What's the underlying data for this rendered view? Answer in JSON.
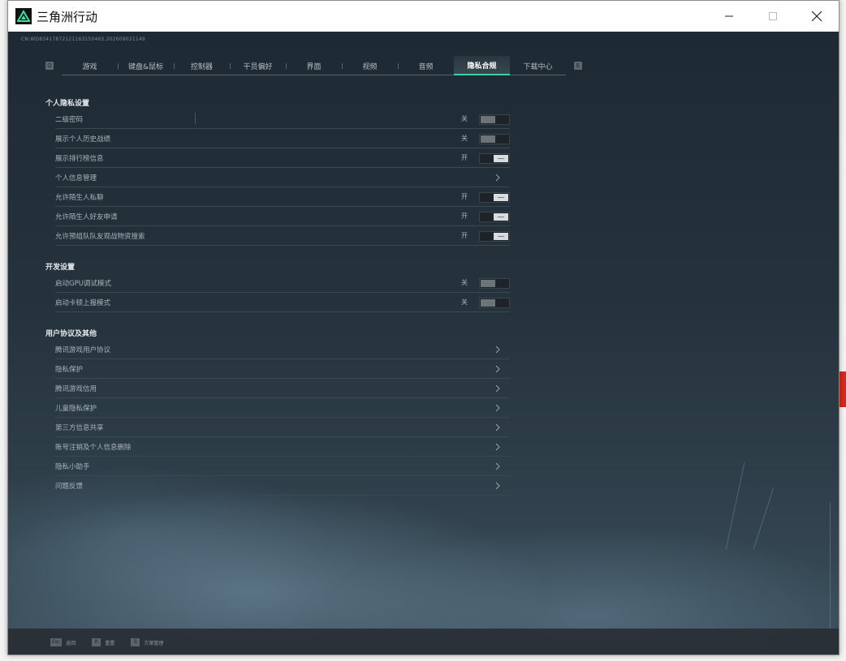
{
  "window": {
    "title": "三角洲行动"
  },
  "version": "CN:WD8341787212116315046S.202609021149",
  "tabs": {
    "prev_key": "Q",
    "next_key": "E",
    "items": [
      {
        "label": "游戏"
      },
      {
        "label": "键盘&鼠标"
      },
      {
        "label": "控制器"
      },
      {
        "label": "干员偏好"
      },
      {
        "label": "界面"
      },
      {
        "label": "视频"
      },
      {
        "label": "音频"
      },
      {
        "label": "隐私合规",
        "active": true
      },
      {
        "label": "下载中心"
      }
    ]
  },
  "sections": {
    "privacy": {
      "title": "个人隐私设置",
      "rows": [
        {
          "label": "二级密码",
          "state": "关"
        },
        {
          "label": "展示个人历史战绩",
          "state": "关"
        },
        {
          "label": "展示排行榜信息",
          "state": "开"
        },
        {
          "label": "个人信息管理"
        },
        {
          "label": "允许陌生人私聊",
          "state": "开"
        },
        {
          "label": "允许陌生人好友申请",
          "state": "开"
        },
        {
          "label": "允许预组队队友观战物资搜索",
          "state": "开"
        }
      ]
    },
    "dev": {
      "title": "开发设置",
      "rows": [
        {
          "label": "启动GPU调试模式",
          "state": "关"
        },
        {
          "label": "启动卡顿上报模式",
          "state": "关"
        }
      ]
    },
    "agreements": {
      "title": "用户协议及其他",
      "rows": [
        {
          "label": "腾讯游戏用户协议"
        },
        {
          "label": "隐私保护"
        },
        {
          "label": "腾讯游戏信用"
        },
        {
          "label": "儿童隐私保护"
        },
        {
          "label": "第三方信息共享"
        },
        {
          "label": "账号注销及个人信息删除"
        },
        {
          "label": "隐私小助手"
        },
        {
          "label": "问题反馈"
        }
      ]
    }
  },
  "footer": {
    "items": [
      {
        "key": "Esc",
        "label": "返回"
      },
      {
        "key": "R",
        "label": "重置"
      },
      {
        "key": "S",
        "label": "方案管理"
      }
    ]
  },
  "colors": {
    "accent": "#37d3a0",
    "toggle_on": "#d8dcde",
    "toggle_off": "#6c7478"
  }
}
